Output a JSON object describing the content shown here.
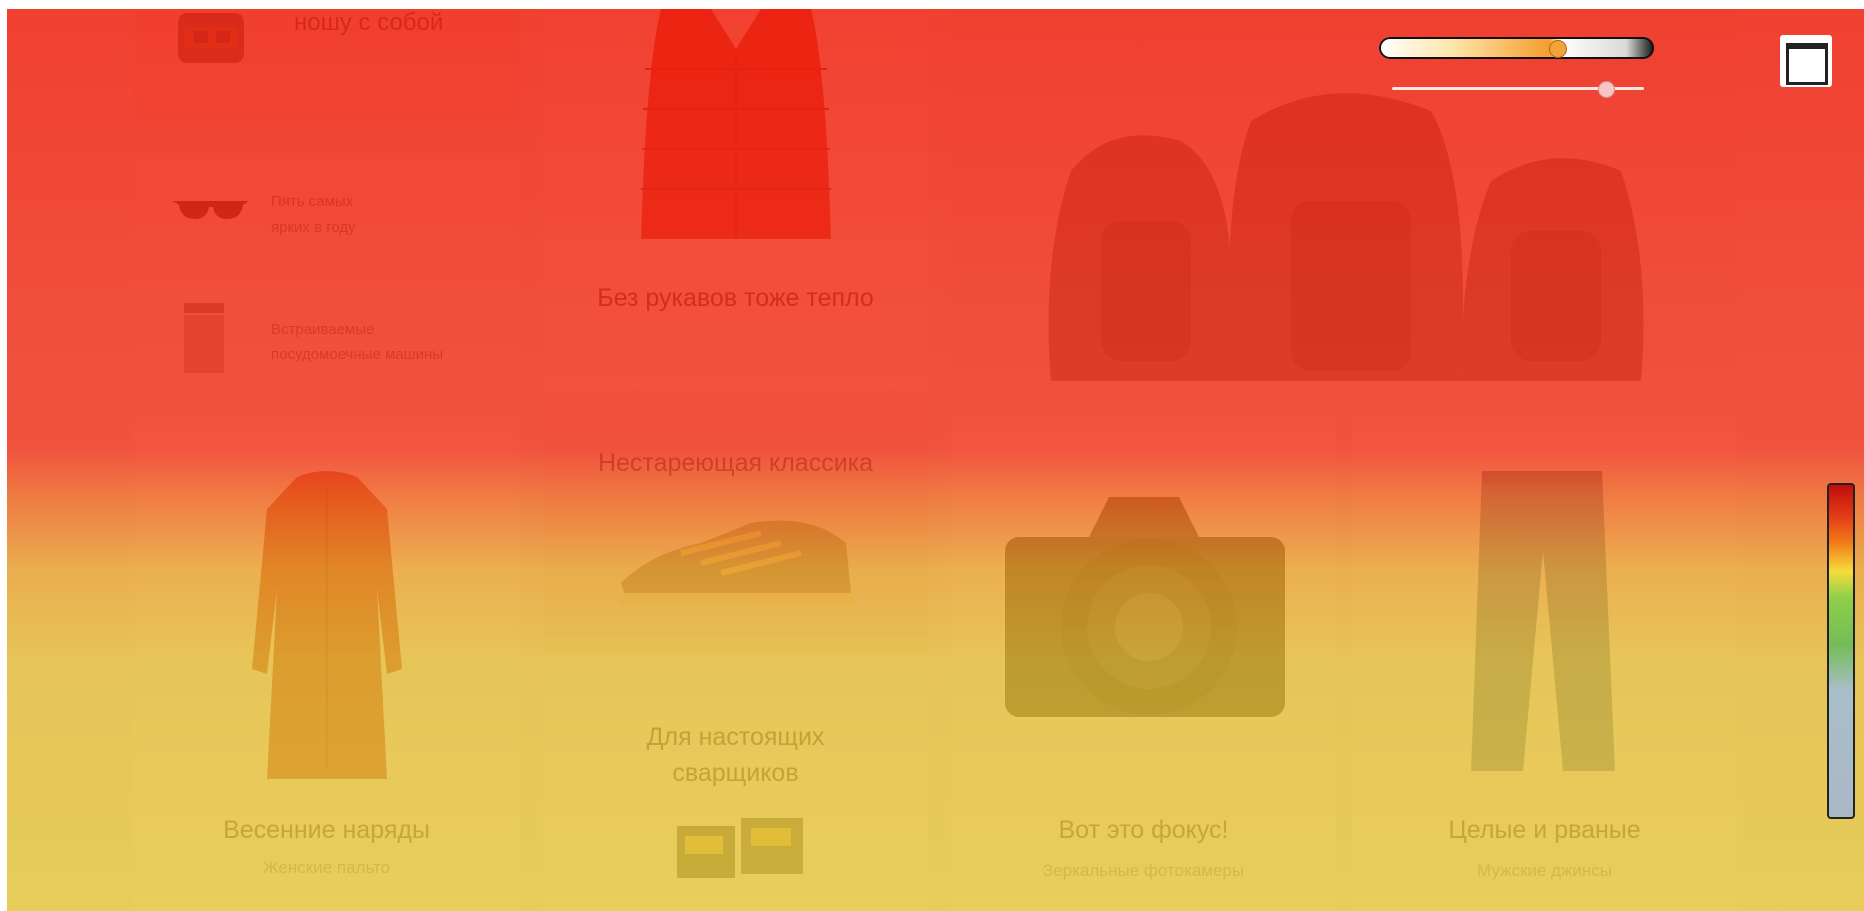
{
  "tiles": {
    "backpack": {
      "title": "ношу с собой"
    },
    "sunglasses": {
      "label_line1": "Пять самых",
      "label_line2": "ярких в году"
    },
    "dishwasher": {
      "label_line1": "Встраиваемые",
      "label_line2": "посудомоечные машины"
    },
    "vest": {
      "title": "Без рукавов тоже тепло"
    },
    "coat": {
      "title": "Весенние наряды",
      "subtitle": "Женские пальто"
    },
    "sneaker": {
      "title": "Нестареющая классика"
    },
    "welder": {
      "title_line1": "Для настоящих",
      "title_line2": "сварщиков"
    },
    "camera": {
      "title": "Вот это фокус!",
      "subtitle": "Зеркальные фотокамеры"
    },
    "jeans": {
      "title": "Целые и рваные",
      "subtitle": "Мужские джинсы"
    }
  },
  "heatmap": {
    "opacity_level": 0.66,
    "radius_level": 0.82,
    "legend_colors": [
      "#c00c0c",
      "#f07818",
      "#f6dc3a",
      "#74bc58",
      "#aab7c7"
    ]
  },
  "icons": {
    "fullscreen": "fullscreen-icon"
  }
}
